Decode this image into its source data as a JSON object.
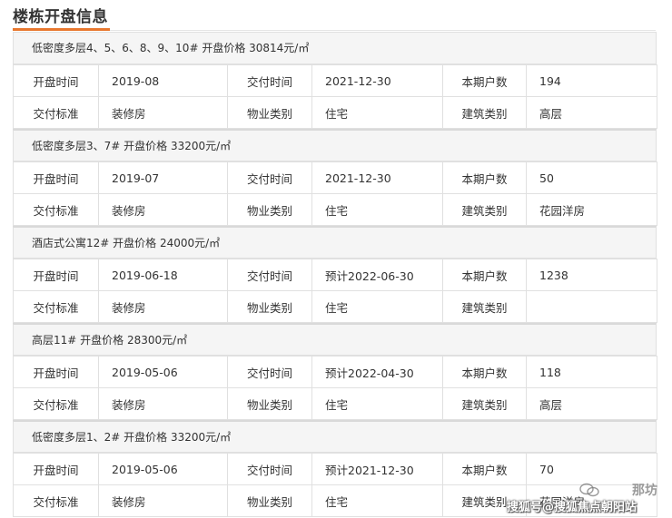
{
  "page": {
    "title": "楼栋开盘信息"
  },
  "colors": {
    "accent": "#e8772e",
    "head_bg": "#f5f5f5",
    "border": "#e0e0e0"
  },
  "labels": {
    "open_time": "开盘时间",
    "delivery_time": "交付时间",
    "households": "本期户数",
    "delivery_standard": "交付标准",
    "property_type": "物业类别",
    "building_type": "建筑类别"
  },
  "blocks": [
    {
      "header": "低密度多层4、5、6、8、9、10# 开盘价格 30814元/㎡",
      "open_time": "2019-08",
      "delivery_time": "2021-12-30",
      "households": "194",
      "delivery_standard": "装修房",
      "property_type": "住宅",
      "building_type": "高层"
    },
    {
      "header": "低密度多层3、7# 开盘价格 33200元/㎡",
      "open_time": "2019-07",
      "delivery_time": "2021-12-30",
      "households": "50",
      "delivery_standard": "装修房",
      "property_type": "住宅",
      "building_type": "花园洋房"
    },
    {
      "header": "酒店式公寓12# 开盘价格 24000元/㎡",
      "open_time": "2019-06-18",
      "delivery_time": "预计2022-06-30",
      "households": "1238",
      "delivery_standard": "装修房",
      "property_type": "住宅",
      "building_type": ""
    },
    {
      "header": "高层11# 开盘价格 28300元/㎡",
      "open_time": "2019-05-06",
      "delivery_time": "预计2022-04-30",
      "households": "118",
      "delivery_standard": "装修房",
      "property_type": "住宅",
      "building_type": "高层"
    },
    {
      "header": "低密度多层1、2# 开盘价格 33200元/㎡",
      "open_time": "2019-05-06",
      "delivery_time": "预计2021-12-30",
      "households": "70",
      "delivery_standard": "装修房",
      "property_type": "住宅",
      "building_type": "花园洋房"
    }
  ],
  "watermark": {
    "top": "那坊",
    "bottom": "搜狐号@搜狐焦点朝阳站",
    "icon": "wechat-icon"
  }
}
